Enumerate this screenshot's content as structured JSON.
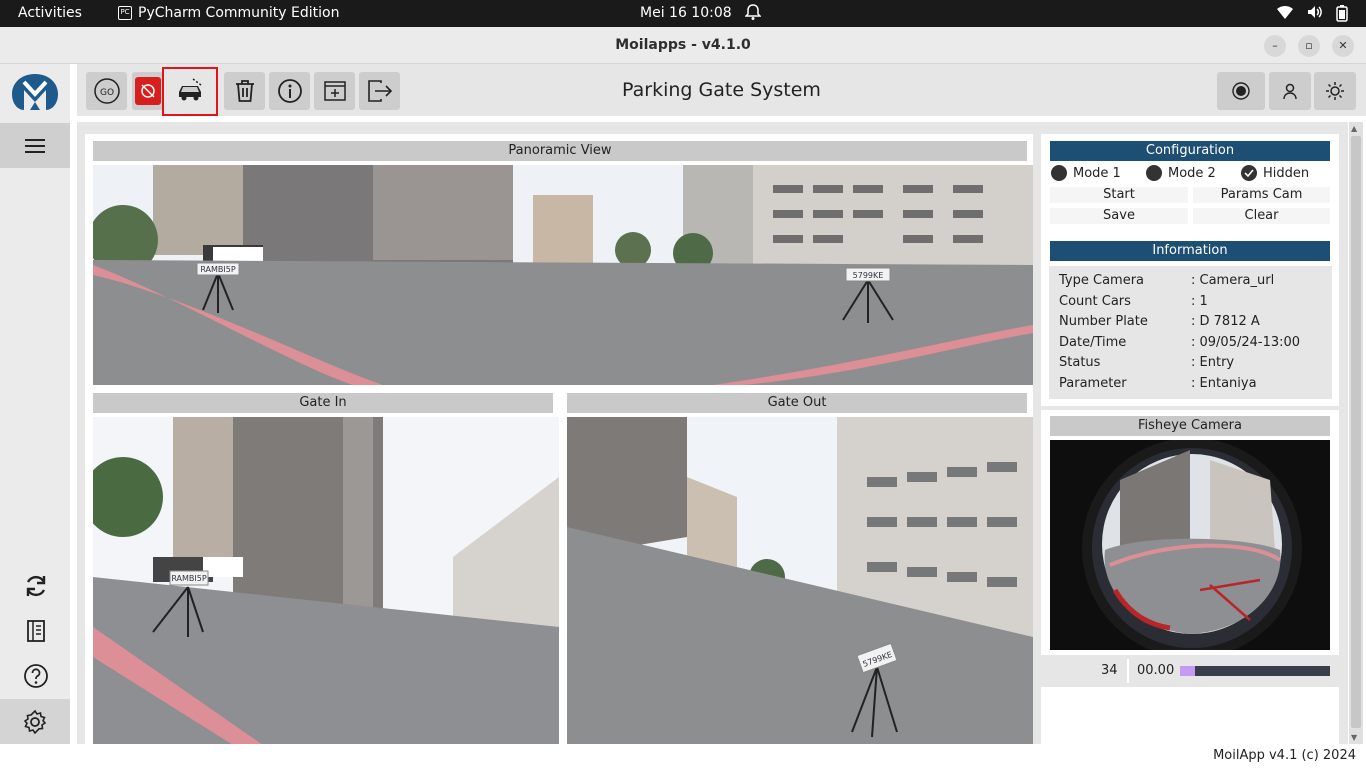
{
  "topbar": {
    "activities": "Activities",
    "app_name": "PyCharm Community Edition",
    "app_icon_text": "PC",
    "clock": "Mei 16  10:08"
  },
  "window": {
    "title": "Moilapps - v4.1.0"
  },
  "app": {
    "title": "Parking Gate System"
  },
  "toolbar": {
    "go_label": "GO"
  },
  "views": {
    "panoramic": "Panoramic View",
    "gate_in": "Gate In",
    "gate_out": "Gate Out",
    "plate_left": "RAMBI5P",
    "plate_right": "5799KE"
  },
  "config": {
    "header": "Configuration",
    "mode1": "Mode 1",
    "mode2": "Mode 2",
    "hidden": "Hidden",
    "start": "Start",
    "params_cam": "Params Cam",
    "save": "Save",
    "clear": "Clear"
  },
  "info": {
    "header": "Information",
    "rows": [
      {
        "key": "Type Camera",
        "value": ": Camera_url"
      },
      {
        "key": "Count Cars",
        "value": ": 1"
      },
      {
        "key": "Number Plate",
        "value": ": D 7812 A"
      },
      {
        "key": "Date/Time",
        "value": ": 09/05/24-13:00"
      },
      {
        "key": "Status",
        "value": ": Entry"
      },
      {
        "key": "Parameter",
        "value": ": Entaniya"
      }
    ]
  },
  "fisheye": {
    "header": "Fisheye Camera",
    "count": "34",
    "time": "00.00",
    "progress_fraction": 0.1
  },
  "footer": {
    "text": "MoilApp v4.1 (c) 2024"
  },
  "colors": {
    "header_blue": "#1d4e74",
    "highlight_red": "#e0141a",
    "progress_purple": "#c39bf0",
    "track": "#3a3d4a"
  }
}
